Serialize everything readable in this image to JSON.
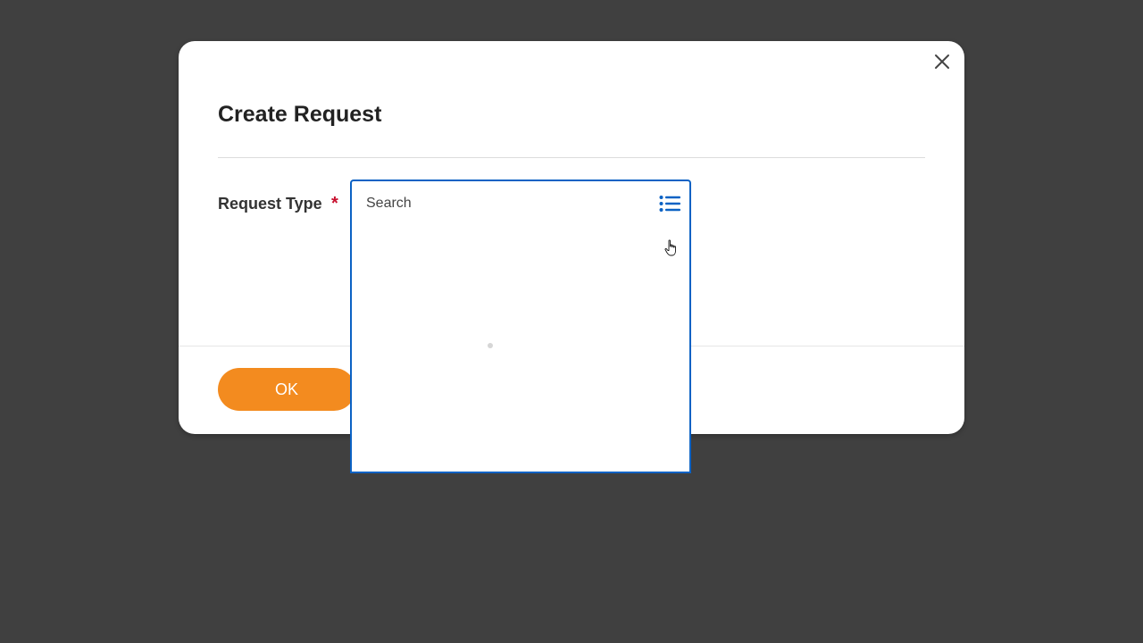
{
  "dialog": {
    "title": "Create Request",
    "close_icon": "close-icon",
    "field": {
      "label": "Request Type",
      "required_marker": "*",
      "search_placeholder": "Search",
      "search_value": "",
      "list_icon": "list-icon"
    },
    "ok_label": "OK"
  },
  "dropdown": {
    "state": "loading",
    "items": []
  },
  "colors": {
    "overlay": "#404040",
    "accent_blue": "#0b62c4",
    "ok_orange": "#f38b1f",
    "required_red": "#c8102e"
  }
}
